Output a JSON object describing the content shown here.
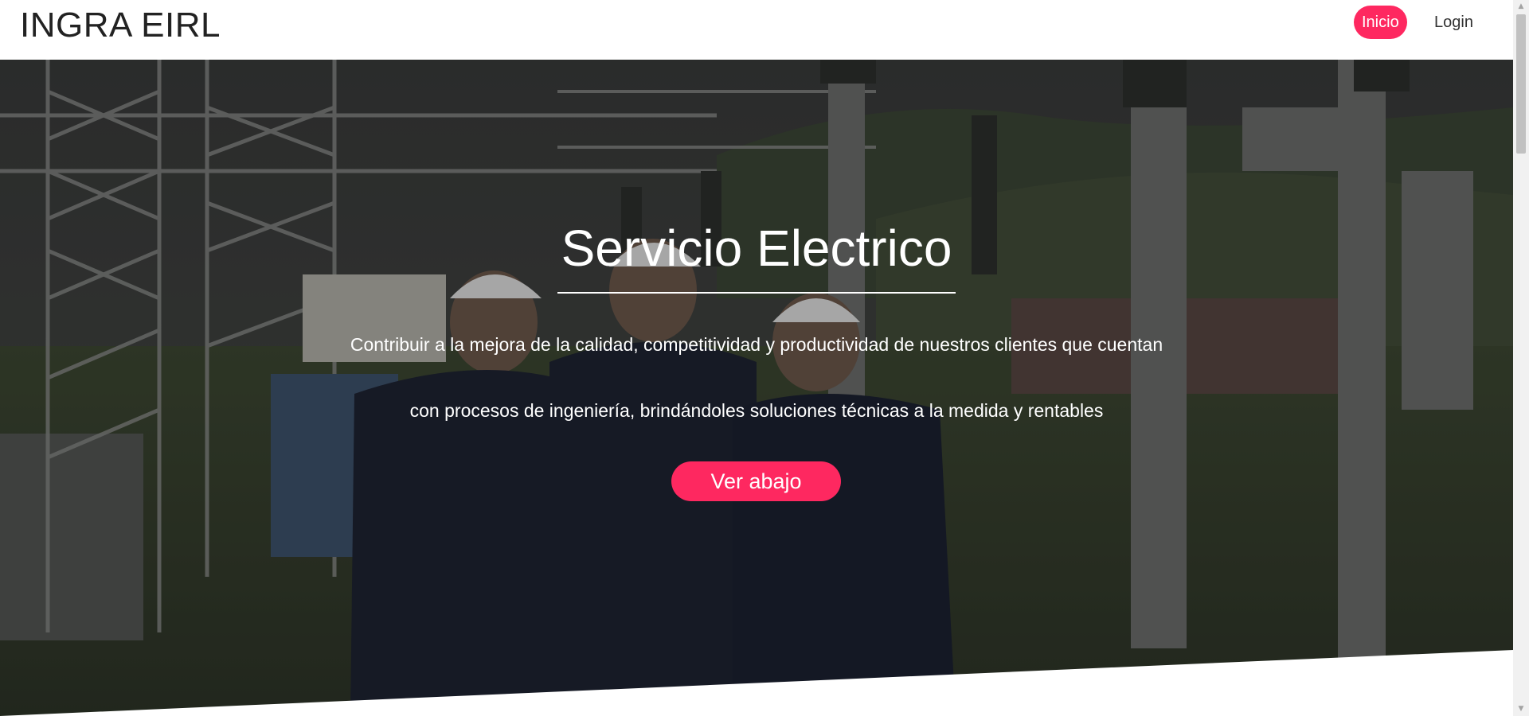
{
  "navbar": {
    "brand": "INGRA EIRL",
    "items": [
      {
        "label": "Inicio",
        "active": true
      },
      {
        "label": "Login",
        "active": false
      }
    ]
  },
  "hero": {
    "title": "Servicio Electrico",
    "line1": "Contribuir a la mejora de la calidad, competitividad y productividad de nuestros clientes que cuentan",
    "line2": "con procesos de ingeniería, brindándoles soluciones técnicas a la medida y rentables",
    "cta_label": "Ver abajo",
    "background": "photo-electric-substation-workers"
  },
  "colors": {
    "accent": "#fe2860",
    "text_on_hero": "#ffffff",
    "brand_text": "#222222"
  },
  "icons": {
    "scroll_up": "▲",
    "scroll_down": "▼"
  }
}
